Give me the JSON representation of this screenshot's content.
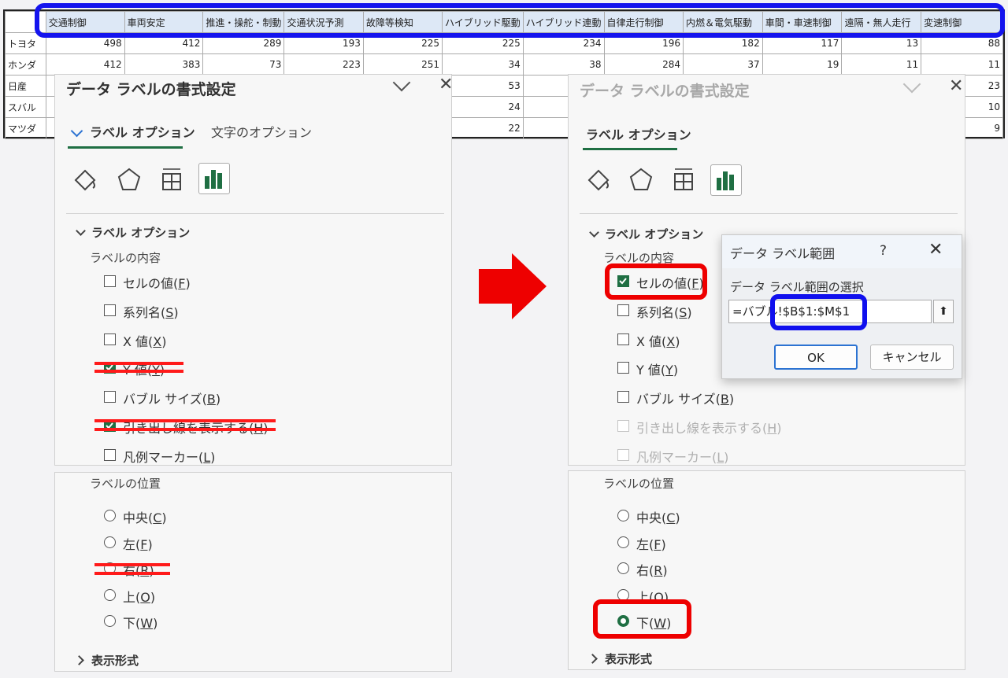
{
  "sheet": {
    "headers": [
      "交通制御",
      "車両安定",
      "推進・操舵・制動",
      "交通状況予測",
      "故障等検知",
      "ハイブリッド駆動",
      "ハイブリッド連動",
      "自律走行制御",
      "内燃＆電気駆動",
      "車間・車速制御",
      "遠隔・無人走行",
      "変速制御"
    ],
    "rows": [
      {
        "label": "トヨタ",
        "values": [
          "498",
          "412",
          "289",
          "193",
          "225",
          "225",
          "234",
          "196",
          "182",
          "117",
          "13",
          "88"
        ]
      },
      {
        "label": "ホンダ",
        "values": [
          "412",
          "383",
          "73",
          "223",
          "251",
          "34",
          "38",
          "284",
          "37",
          "19",
          "11",
          "11"
        ]
      },
      {
        "label": "日産",
        "values": [
          "",
          "",
          "",
          "",
          "",
          "53",
          "",
          "",
          "",
          "",
          "",
          "23"
        ]
      },
      {
        "label": "スバル",
        "values": [
          "",
          "",
          "",
          "",
          "",
          "24",
          "",
          "",
          "",
          "",
          "",
          "10"
        ]
      },
      {
        "label": "マツダ",
        "values": [
          "",
          "",
          "",
          "",
          "",
          "22",
          "",
          "",
          "",
          "",
          "",
          "9"
        ]
      }
    ]
  },
  "left_panel": {
    "title": "データ ラベルの書式設定",
    "tab_active": "ラベル オプション",
    "tab_other": "文字のオプション",
    "section": "ラベル オプション",
    "contents_label": "ラベルの内容",
    "checkboxes": [
      {
        "label": "セルの値(",
        "key": "F",
        "checked": false
      },
      {
        "label": "系列名(",
        "key": "S",
        "checked": false
      },
      {
        "label": "X 値(",
        "key": "X",
        "checked": false
      },
      {
        "label": "Y 値(",
        "key": "Y",
        "checked": true
      },
      {
        "label": "バブル サイズ(",
        "key": "B",
        "checked": false
      },
      {
        "label": "引き出し線を表示する(",
        "key": "H",
        "checked": true
      },
      {
        "label": "凡例マーカー(",
        "key": "L",
        "checked": false
      }
    ],
    "position_label": "ラベルの位置",
    "radios": [
      {
        "label": "中央(",
        "key": "C"
      },
      {
        "label": "左(",
        "key": "F"
      },
      {
        "label": "右(",
        "key": "R"
      },
      {
        "label": "上(",
        "key": "O"
      },
      {
        "label": "下(",
        "key": "W"
      }
    ],
    "format_section": "表示形式"
  },
  "right_panel": {
    "title": "データ ラベルの書式設定",
    "tab_active": "ラベル オプション",
    "section": "ラベル オプション",
    "contents_label": "ラベルの内容",
    "checkboxes": [
      {
        "label": "セルの値(",
        "key": "F",
        "checked": true
      },
      {
        "label": "系列名(",
        "key": "S",
        "checked": false
      },
      {
        "label": "X 値(",
        "key": "X",
        "checked": false
      },
      {
        "label": "Y 値(",
        "key": "Y",
        "checked": false
      },
      {
        "label": "バブル サイズ(",
        "key": "B",
        "checked": false
      },
      {
        "label": "引き出し線を表示する(",
        "key": "H",
        "checked": false,
        "disabled": true
      },
      {
        "label": "凡例マーカー(",
        "key": "L",
        "checked": false,
        "disabled": true
      }
    ],
    "position_label": "ラベルの位置",
    "radios": [
      {
        "label": "中央(",
        "key": "C"
      },
      {
        "label": "左(",
        "key": "F"
      },
      {
        "label": "右(",
        "key": "R"
      },
      {
        "label": "上(",
        "key": "O"
      },
      {
        "label": "下(",
        "key": "W",
        "selected": true
      }
    ],
    "format_section": "表示形式"
  },
  "dialog": {
    "title": "データ ラベル範囲",
    "help": "?",
    "prompt": "データ ラベル範囲の選択",
    "input_prefix": "=バブル!",
    "input_range": "$B$1:$M$1",
    "ok": "OK",
    "cancel": "キャンセル"
  },
  "colors": {
    "accent": "#1f6f43",
    "arrow": "#ee0000",
    "highlight_blue": "#1414ee"
  }
}
